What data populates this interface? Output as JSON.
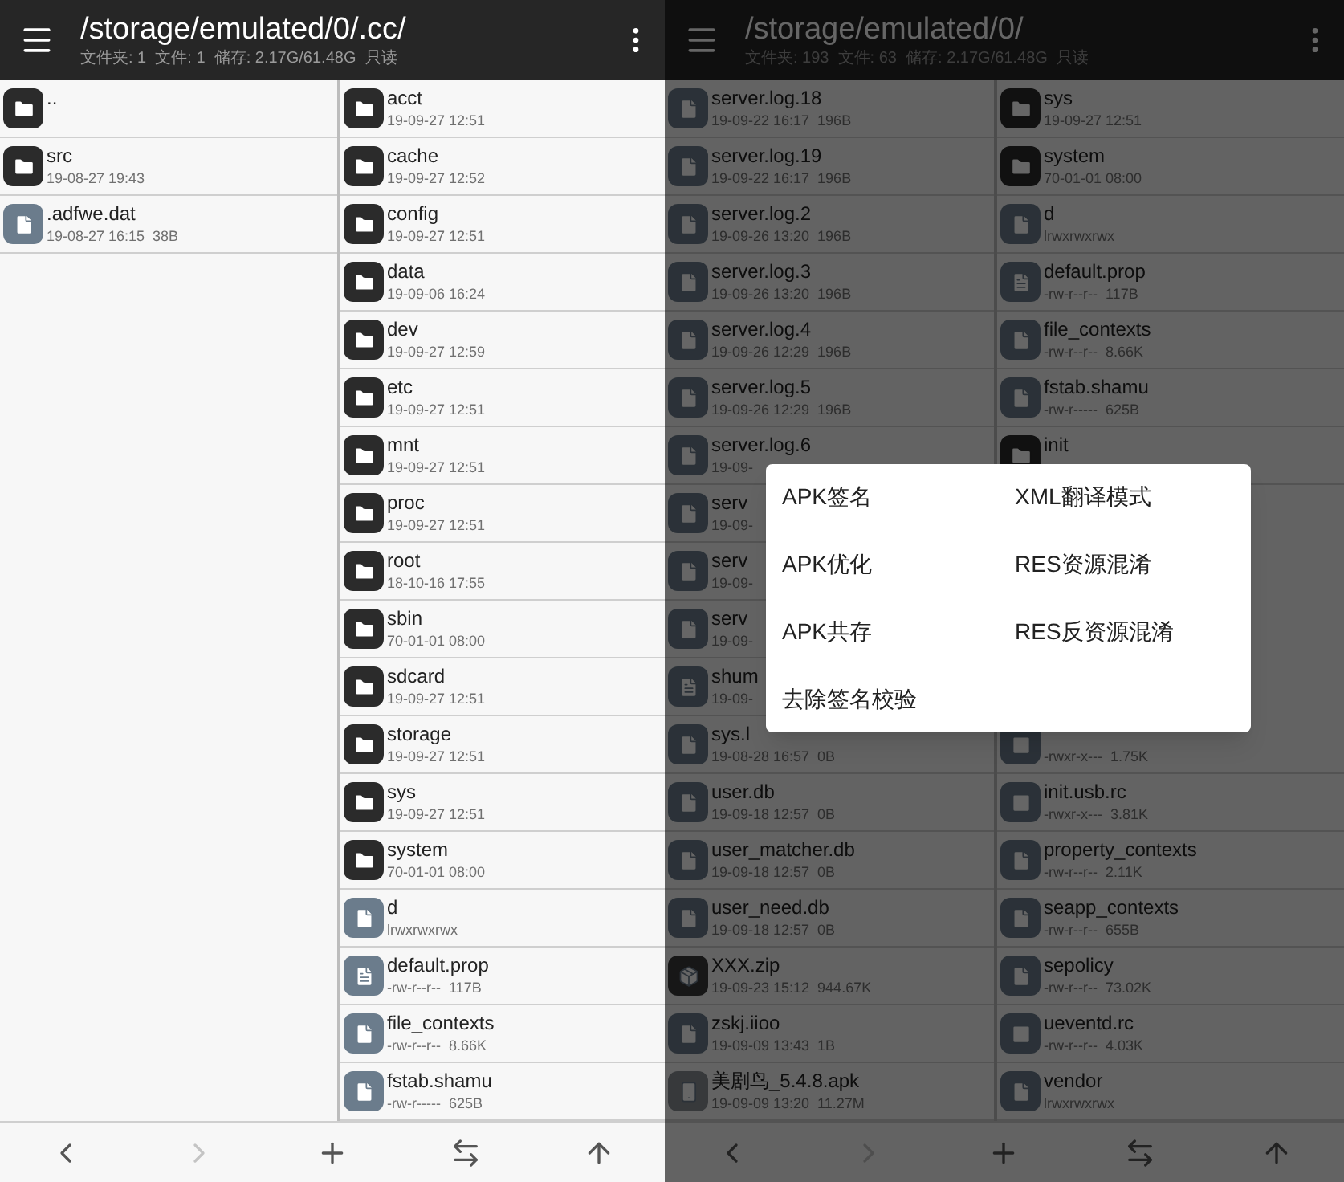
{
  "screens": [
    {
      "dimmed": false,
      "header": {
        "path": "/storage/emulated/0/.cc/",
        "summary": "文件夹: 1  文件: 1  储存: 2.17G/61.48G  只读"
      },
      "columns": [
        {
          "items": [
            {
              "kind": "folder",
              "name": ".."
            },
            {
              "kind": "folder",
              "name": "src",
              "detail": "19-08-27 19:43"
            },
            {
              "kind": "file",
              "name": ".adfwe.dat",
              "detail": "19-08-27 16:15  38B"
            }
          ]
        },
        {
          "items": [
            {
              "kind": "folder",
              "name": "acct",
              "detail": "19-09-27 12:51"
            },
            {
              "kind": "folder",
              "name": "cache",
              "detail": "19-09-27 12:52"
            },
            {
              "kind": "folder",
              "name": "config",
              "detail": "19-09-27 12:51"
            },
            {
              "kind": "folder",
              "name": "data",
              "detail": "19-09-06 16:24"
            },
            {
              "kind": "folder",
              "name": "dev",
              "detail": "19-09-27 12:59"
            },
            {
              "kind": "folder",
              "name": "etc",
              "detail": "19-09-27 12:51"
            },
            {
              "kind": "folder",
              "name": "mnt",
              "detail": "19-09-27 12:51"
            },
            {
              "kind": "folder",
              "name": "proc",
              "detail": "19-09-27 12:51"
            },
            {
              "kind": "folder",
              "name": "root",
              "detail": "18-10-16 17:55"
            },
            {
              "kind": "folder",
              "name": "sbin",
              "detail": "70-01-01 08:00"
            },
            {
              "kind": "folder",
              "name": "sdcard",
              "detail": "19-09-27 12:51"
            },
            {
              "kind": "folder",
              "name": "storage",
              "detail": "19-09-27 12:51"
            },
            {
              "kind": "folder",
              "name": "sys",
              "detail": "19-09-27 12:51"
            },
            {
              "kind": "folder",
              "name": "system",
              "detail": "70-01-01 08:00"
            },
            {
              "kind": "file",
              "name": "d",
              "detail": "lrwxrwxrwx"
            },
            {
              "kind": "text",
              "name": "default.prop",
              "detail": "-rw-r--r--  117B"
            },
            {
              "kind": "file",
              "name": "file_contexts",
              "detail": "-rw-r--r--  8.66K"
            },
            {
              "kind": "file",
              "name": "fstab.shamu",
              "detail": "-rw-r-----  625B"
            }
          ]
        }
      ],
      "toolbar": [
        {
          "kind": "back",
          "disabled": false
        },
        {
          "kind": "forward",
          "disabled": true
        },
        {
          "kind": "add",
          "disabled": false
        },
        {
          "kind": "swap",
          "disabled": false
        },
        {
          "kind": "up",
          "disabled": false
        }
      ]
    },
    {
      "dimmed": true,
      "header": {
        "path": "/storage/emulated/0/",
        "summary": "文件夹: 193  文件: 63  储存: 2.17G/61.48G  只读"
      },
      "columns": [
        {
          "items": [
            {
              "kind": "file",
              "name": "server.log.18",
              "detail": "19-09-22 16:17  196B"
            },
            {
              "kind": "file",
              "name": "server.log.19",
              "detail": "19-09-22 16:17  196B"
            },
            {
              "kind": "file",
              "name": "server.log.2",
              "detail": "19-09-26 13:20  196B"
            },
            {
              "kind": "file",
              "name": "server.log.3",
              "detail": "19-09-26 13:20  196B"
            },
            {
              "kind": "file",
              "name": "server.log.4",
              "detail": "19-09-26 12:29  196B"
            },
            {
              "kind": "file",
              "name": "server.log.5",
              "detail": "19-09-26 12:29  196B"
            },
            {
              "kind": "file",
              "name": "server.log.6",
              "detail": "19-09-"
            },
            {
              "kind": "file",
              "name": "serv",
              "detail": "19-09-"
            },
            {
              "kind": "file",
              "name": "serv",
              "detail": "19-09-"
            },
            {
              "kind": "file",
              "name": "serv",
              "detail": "19-09-"
            },
            {
              "kind": "text",
              "name": "shum",
              "detail": "19-09-"
            },
            {
              "kind": "file",
              "name": "sys.l",
              "detail": "19-08-28 16:57  0B"
            },
            {
              "kind": "file",
              "name": "user.db",
              "detail": "19-09-18 12:57  0B"
            },
            {
              "kind": "file",
              "name": "user_matcher.db",
              "detail": "19-09-18 12:57  0B"
            },
            {
              "kind": "file",
              "name": "user_need.db",
              "detail": "19-09-18 12:57  0B"
            },
            {
              "kind": "archive",
              "name": "XXX.zip",
              "detail": "19-09-23 15:12  944.67K"
            },
            {
              "kind": "file",
              "name": "zskj.iioo",
              "detail": "19-09-09 13:43  1B"
            },
            {
              "kind": "apk",
              "name": "美剧鸟_5.4.8.apk",
              "detail": "19-09-09 13:20  11.27M"
            }
          ]
        },
        {
          "items": [
            {
              "kind": "folder",
              "name": "sys",
              "detail": "19-09-27 12:51"
            },
            {
              "kind": "folder",
              "name": "system",
              "detail": "70-01-01 08:00"
            },
            {
              "kind": "file",
              "name": "d",
              "detail": "lrwxrwxrwx"
            },
            {
              "kind": "text",
              "name": "default.prop",
              "detail": "-rw-r--r--  117B"
            },
            {
              "kind": "file",
              "name": "file_contexts",
              "detail": "-rw-r--r--  8.66K"
            },
            {
              "kind": "file",
              "name": "fstab.shamu",
              "detail": "-rw-r-----  625B"
            },
            {
              "kind": "folder",
              "name": "init"
            }
          ],
          "bottom_items": [
            {
              "kind": "script",
              "detail": "-rwxr-x---  1.75K"
            },
            {
              "kind": "script",
              "name": "init.usb.rc",
              "detail": "-rwxr-x---  3.81K"
            },
            {
              "kind": "file",
              "name": "property_contexts",
              "detail": "-rw-r--r--  2.11K"
            },
            {
              "kind": "file",
              "name": "seapp_contexts",
              "detail": "-rw-r--r--  655B"
            },
            {
              "kind": "file",
              "name": "sepolicy",
              "detail": "-rw-r--r--  73.02K"
            },
            {
              "kind": "script",
              "name": "ueventd.rc",
              "detail": "-rw-r--r--  4.03K"
            },
            {
              "kind": "file",
              "name": "vendor",
              "detail": "lrwxrwxrwx"
            }
          ]
        }
      ],
      "toolbar": [
        {
          "kind": "back",
          "disabled": false
        },
        {
          "kind": "forward",
          "disabled": true
        },
        {
          "kind": "add",
          "disabled": false
        },
        {
          "kind": "swap",
          "disabled": false
        },
        {
          "kind": "up",
          "disabled": false
        }
      ],
      "dialog": {
        "options": [
          "APK签名",
          "XML翻译模式",
          "APK优化",
          "RES资源混淆",
          "APK共存",
          "RES反资源混淆",
          "去除签名校验"
        ]
      }
    }
  ]
}
